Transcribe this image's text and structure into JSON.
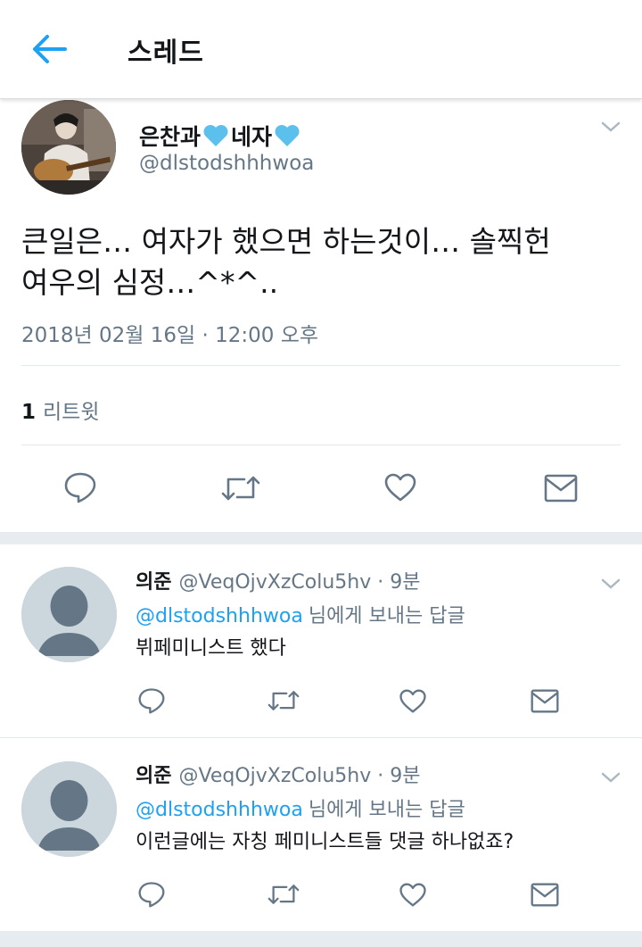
{
  "header": {
    "title": "스레드",
    "back_icon": "arrow-left-icon",
    "accent": "#1da1f2"
  },
  "main_tweet": {
    "author_name_prefix": "은찬과",
    "author_name_mid": "네자",
    "name_icon": "blue-heart-icon",
    "author_handle": "@dlstodshhhwoa",
    "text_line1": "큰일은… 여자가 했으면 하는것이… 솔찍헌",
    "text_line2": "여우의 심정…^*^..",
    "timestamp": "2018년 02월 16일 · 12:00 오후",
    "retweet_count": "1",
    "retweet_label": "리트윗",
    "actions": [
      "reply-icon",
      "retweet-icon",
      "like-icon",
      "direct-message-icon"
    ]
  },
  "replies": [
    {
      "name": "의준",
      "meta": "@VeqOjvXzColu5hv · 9분",
      "reply_to_handle": "@dlstodshhhwoa",
      "reply_to_suffix": "님에게 보내는 답글",
      "text": "뷔페미니스트 했다"
    },
    {
      "name": "의준",
      "meta": "@VeqOjvXzColu5hv · 9분",
      "reply_to_handle": "@dlstodshhhwoa",
      "reply_to_suffix": "님에게 보내는 답글",
      "text": "이런글에는 자칭 페미니스트들 댓글 하나없죠?"
    }
  ]
}
